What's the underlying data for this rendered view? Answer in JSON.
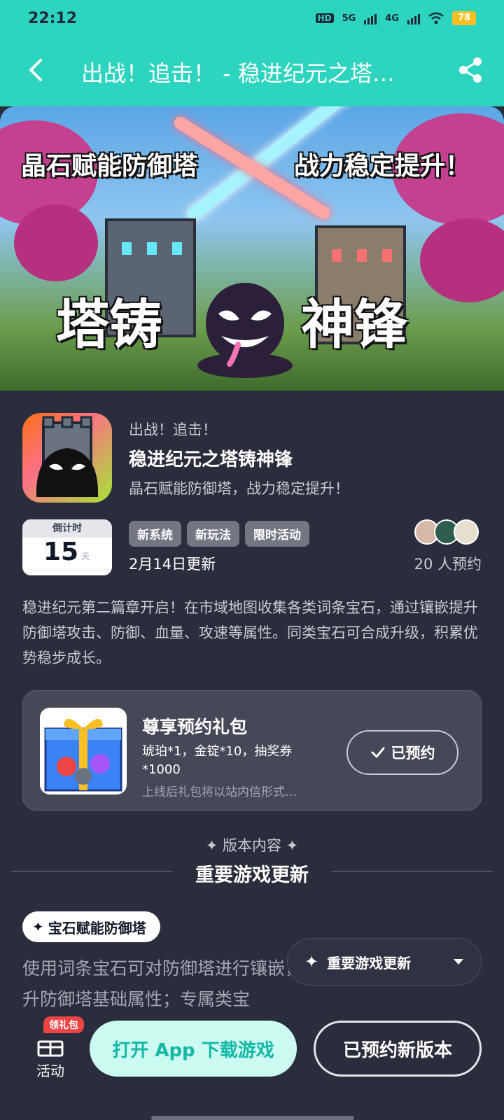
{
  "status_bar": {
    "time": "22:12",
    "network1": "5G",
    "network2": "4G",
    "battery": "78"
  },
  "header": {
    "title": "出战！追击！ - 稳进纪元之塔…"
  },
  "banner": {
    "left_text": "晶石赋能防御塔",
    "right_text": "战力稳定提升！",
    "logo_left": "塔铸",
    "logo_right": "神锋"
  },
  "app": {
    "subtitle": "出战！追击！",
    "name": "稳进纪元之塔铸神锋",
    "tagline": "晶石赋能防御塔，战力稳定提升！"
  },
  "countdown": {
    "label": "倒计时",
    "value": "15",
    "unit": "天"
  },
  "tags": [
    "新系统",
    "新玩法",
    "限时活动"
  ],
  "update_date": "2月14日更新",
  "reserve_count": "20 人预约",
  "description": "稳进纪元第二篇章开启！在市域地图收集各类词条宝石，通过镶嵌提升防御塔攻击、防御、血量、攻速等属性。同类宝石可合成升级，积累优势稳步成长。",
  "gift": {
    "title": "尊享预约礼包",
    "items": "琥珀*1，金锭*10，抽奖券*1000",
    "note": "上线后礼包将以站内信形式…",
    "button": "已预约"
  },
  "section": {
    "label": "✦ 版本内容 ✦",
    "title": "重要游戏更新"
  },
  "feature": {
    "chip": "宝石赋能防御塔",
    "text": "使用词条宝石可对防御塔进行镶嵌，适配所有防御塔，可提升防御塔基础属性；专属类宝"
  },
  "floating_menu": {
    "label": "重要游戏更新"
  },
  "bottom": {
    "activity_label": "活动",
    "badge": "领礼包",
    "open_app": "打开 App 下载游戏",
    "reserved_version": "已预约新版本"
  },
  "colors": {
    "accent": "#2dd4bf",
    "background": "#2a2d3b",
    "card": "#454857",
    "badge": "#ef4444"
  }
}
